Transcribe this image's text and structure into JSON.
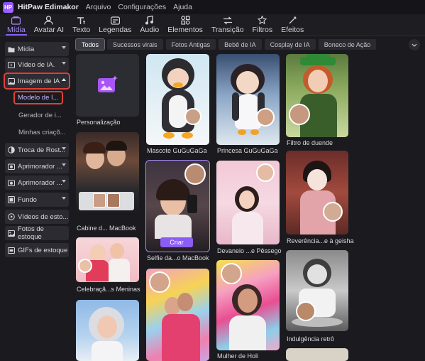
{
  "app": {
    "logo_text": "HP",
    "title": "HitPaw Edimakor"
  },
  "menu": [
    "Arquivo",
    "Configurações",
    "Ajuda"
  ],
  "toolbar": {
    "items": [
      {
        "label": "Mídia",
        "icon": "media-icon",
        "active": true
      },
      {
        "label": "Avatar AI",
        "icon": "avatar-icon"
      },
      {
        "label": "Texto",
        "icon": "text-icon"
      },
      {
        "label": "Legendas",
        "icon": "captions-icon"
      },
      {
        "label": "Áudio",
        "icon": "audio-icon"
      },
      {
        "label": "Elementos",
        "icon": "elements-icon"
      },
      {
        "label": "Transição",
        "icon": "transition-icon"
      },
      {
        "label": "Filtros",
        "icon": "filters-icon"
      },
      {
        "label": "Efeitos",
        "icon": "effects-icon"
      }
    ],
    "accent": "#8b5cf6"
  },
  "sidebar": {
    "items": [
      {
        "label": "Mídia",
        "icon": "folder-icon"
      },
      {
        "label": "Vídeo de IA.",
        "icon": "video-icon"
      },
      {
        "label": "Imagem de IA",
        "icon": "image-icon"
      },
      {
        "label": "Troca de Rost...",
        "icon": "face-swap-icon"
      },
      {
        "label": "Aprimorador ...",
        "icon": "enhance-icon"
      },
      {
        "label": "Aprimorador ...",
        "icon": "enhance-icon"
      },
      {
        "label": "Fundo",
        "icon": "background-icon"
      },
      {
        "label": "Vídeos de esto...",
        "icon": "stock-video-icon"
      },
      {
        "label": "Fotos de estoque",
        "icon": "stock-photo-icon"
      },
      {
        "label": "GIFs de estoque",
        "icon": "gif-icon"
      }
    ],
    "subitems": [
      "Modelo de I...",
      "Gerador de i...",
      "Minhas criaçõ..."
    ],
    "highlight_color": "#e1403a"
  },
  "chips": [
    "Todos",
    "Sucessos virais",
    "Fotos Antigas",
    "Bebê de IA",
    "Cosplay de IA",
    "Boneco de Ação"
  ],
  "cards": [
    {
      "label": "Personalização"
    },
    {
      "label": "Cabine d... MacBook"
    },
    {
      "label": "Celebraçã...s Meninas"
    },
    {
      "label": ""
    },
    {
      "label": "Mascote GuGuGaGa"
    },
    {
      "label": "Selfie da...o MacBook",
      "button": "Criar"
    },
    {
      "label": ""
    },
    {
      "label": "Princesa GuGuGaGa"
    },
    {
      "label": "Devaneio ...e Pêssego"
    },
    {
      "label": "Mulher de Holi"
    },
    {
      "label": "Filtro de duende"
    },
    {
      "label": "Reverência...e à geisha"
    },
    {
      "label": "Indulgência retrô"
    },
    {
      "label": ""
    }
  ]
}
